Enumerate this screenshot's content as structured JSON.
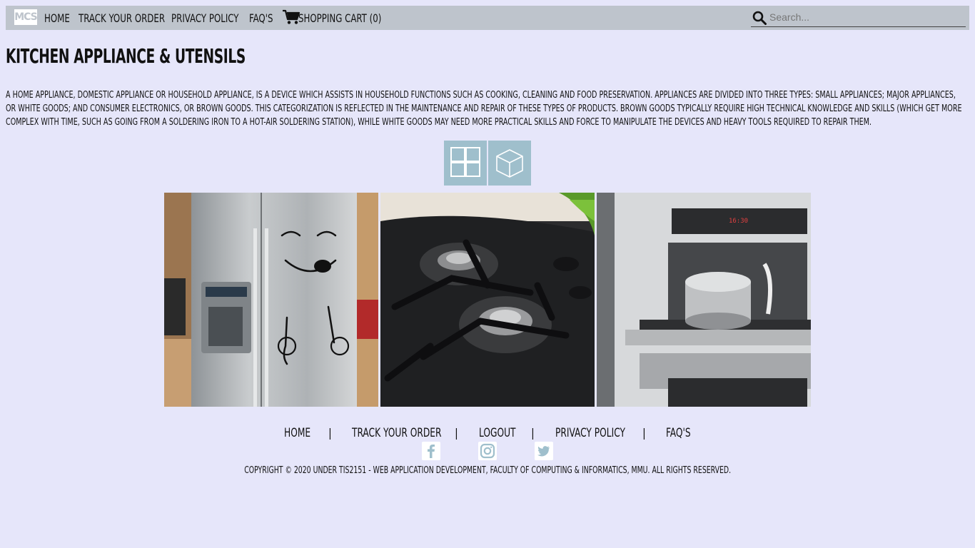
{
  "nav": {
    "logo": "MCS",
    "links": [
      "HOME",
      "TRACK YOUR ORDER",
      "PRIVACY POLICY",
      "FAQ'S"
    ],
    "cart": "SHOPPING CART (0)",
    "search_placeholder": "Search..."
  },
  "page": {
    "title": "KITCHEN APPLIANCE & UTENSILS",
    "description": "A home appliance, domestic appliance or household appliance, is a device which assists in household functions such as cooking, cleaning and food preservation. Appliances are divided into three types: small appliances; major appliances, or white goods; and consumer electronics, or brown goods. This categorization is reflected in the maintenance and repair of these types of products. Brown goods typically require high technical knowledge and skills (which get more complex with time, such as going from a soldering iron to a hot-air soldering station), while white goods may need more practical skills and force to manipulate the devices and heavy tools required to repair them."
  },
  "view_toggle": {
    "icons": [
      "grid-view-icon",
      "3d-cube-view-icon"
    ],
    "color": "#9fbfcc"
  },
  "photos": [
    "fridge-photo",
    "gas-stove-photo",
    "built-in-oven-photo"
  ],
  "footer": {
    "links": [
      "HOME",
      "TRACK YOUR ORDER",
      "LOGOUT",
      "PRIVACY POLICY",
      "FAQ'S"
    ],
    "separator": "|",
    "social": [
      "facebook-icon",
      "instagram-icon",
      "twitter-icon"
    ],
    "copyright": "Copyright © 2020 under TIS2151 - Web Application Development, Faculty of Computing & Informatics, MMU. All rights reserved."
  },
  "colors": {
    "background": "#e6e6fa",
    "navbar": "#bec4cc",
    "accent": "#9fbfcc"
  }
}
